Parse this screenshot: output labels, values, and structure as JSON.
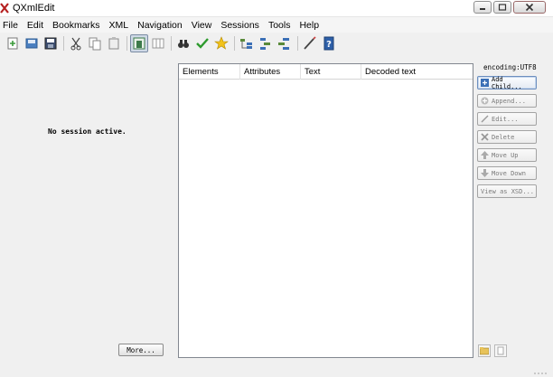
{
  "window": {
    "title": "QXmlEdit"
  },
  "menu": [
    "File",
    "Edit",
    "Bookmarks",
    "XML",
    "Navigation",
    "View",
    "Sessions",
    "Tools",
    "Help"
  ],
  "toolbar_icons": [
    "new-file-icon",
    "open-file-icon",
    "save-icon",
    "cut-icon",
    "copy-icon",
    "paste-icon",
    "view-tree-icon",
    "view-columns-icon",
    "find-icon",
    "validate-icon",
    "bookmark-icon",
    "add-child-icon",
    "add-sibling-icon",
    "indent-icon",
    "edit-icon",
    "help-icon"
  ],
  "left_panel": {
    "status": "No session active.",
    "more_label": "More..."
  },
  "tree": {
    "columns": [
      "Elements",
      "Attributes",
      "Text",
      "Decoded text"
    ]
  },
  "right_panel": {
    "encoding": "encoding:UTF8",
    "buttons": [
      {
        "label": "Add Child...",
        "icon": "add-child-icon",
        "enabled": true
      },
      {
        "label": "Append...",
        "icon": "append-icon",
        "enabled": false
      },
      {
        "label": "Edit...",
        "icon": "edit-icon",
        "enabled": false
      },
      {
        "label": "Delete",
        "icon": "delete-icon",
        "enabled": false
      },
      {
        "label": "Move Up",
        "icon": "move-up-icon",
        "enabled": false
      },
      {
        "label": "Move Down",
        "icon": "move-down-icon",
        "enabled": false
      },
      {
        "label": "View as XSD...",
        "icon": "",
        "enabled": false
      }
    ]
  },
  "colors": {
    "accent": "#3b6fb6",
    "disabled_text": "#7a7a7a"
  }
}
